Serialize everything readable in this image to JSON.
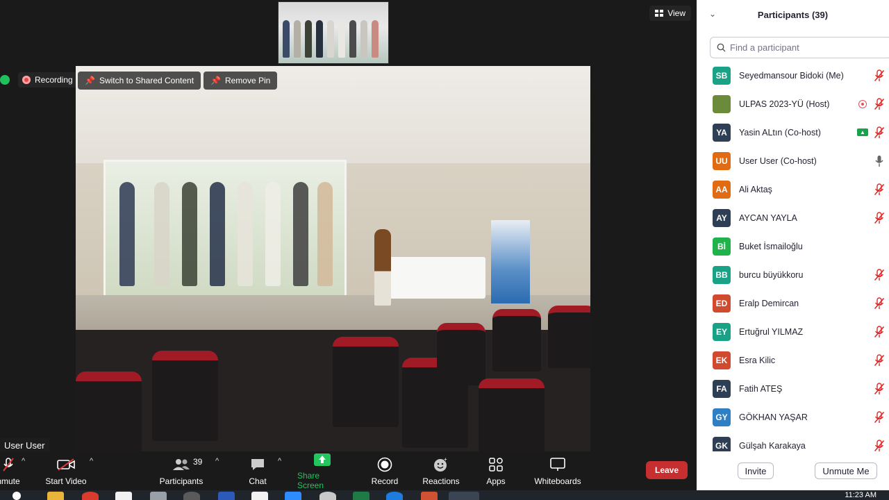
{
  "meeting": {
    "view_label": "View",
    "recording_label": "Recording",
    "switch_label": "Switch to Shared Content",
    "remove_pin_label": "Remove Pin",
    "user_label": "User User"
  },
  "toolbar": {
    "unmute_label": "nmute",
    "start_video_label": "Start Video",
    "participants_label": "Participants",
    "participants_count": "39",
    "chat_label": "Chat",
    "share_label": "Share Screen",
    "record_label": "Record",
    "reactions_label": "Reactions",
    "apps_label": "Apps",
    "whiteboards_label": "Whiteboards",
    "leave_label": "Leave",
    "colors": {
      "share": "#22c55e",
      "leave": "#c62e30"
    }
  },
  "panel": {
    "title": "Participants (39)",
    "search_placeholder": "Find a participant",
    "invite_label": "Invite",
    "unmute_me_label": "Unmute Me",
    "participants": [
      {
        "initials": "SB",
        "name": "Seyedmansour Bidoki (Me)",
        "color": "#1aa286",
        "mic": "muted"
      },
      {
        "initials": "",
        "name": "ULPAS 2023-YÜ (Host)",
        "color": "#6b8a3a",
        "mic": "muted",
        "recording": true
      },
      {
        "initials": "YA",
        "name": "Yasin ALtın (Co-host)",
        "color": "#2d3e55",
        "mic": "muted",
        "sharing": true
      },
      {
        "initials": "UU",
        "name": "User User (Co-host)",
        "color": "#e06b12",
        "mic": "on"
      },
      {
        "initials": "AA",
        "name": "Ali Aktaş",
        "color": "#e06b12",
        "mic": "muted"
      },
      {
        "initials": "AY",
        "name": "AYCAN YAYLA",
        "color": "#2d3e55",
        "mic": "muted"
      },
      {
        "initials": "Bİ",
        "name": "Buket İsmailoğlu",
        "color": "#22b24c",
        "mic": "none"
      },
      {
        "initials": "BB",
        "name": "burcu büyükkoru",
        "color": "#1aa286",
        "mic": "muted"
      },
      {
        "initials": "ED",
        "name": "Eralp Demircan",
        "color": "#d04a30",
        "mic": "muted"
      },
      {
        "initials": "EY",
        "name": "Ertuğrul YILMAZ",
        "color": "#1aa286",
        "mic": "muted"
      },
      {
        "initials": "EK",
        "name": "Esra Kilic",
        "color": "#d04a30",
        "mic": "muted"
      },
      {
        "initials": "FA",
        "name": "Fatih ATEŞ",
        "color": "#2d3e55",
        "mic": "muted"
      },
      {
        "initials": "GY",
        "name": "GÖKHAN YAŞAR",
        "color": "#2f7fc4",
        "mic": "muted"
      },
      {
        "initials": "GK",
        "name": "Gülşah Karakaya",
        "color": "#2d3e55",
        "mic": "muted"
      }
    ]
  },
  "taskbar": {
    "clock": "11:23 AM"
  }
}
